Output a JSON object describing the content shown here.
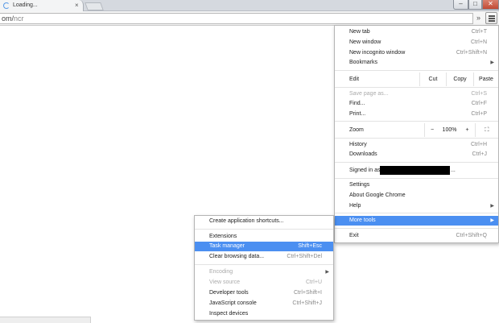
{
  "tab": {
    "title": "Loading..."
  },
  "window_controls": {
    "minimize": "–",
    "maximize": "□",
    "close": "✕"
  },
  "omnibox": {
    "url_host_tail": "om/",
    "url_path": "ncr",
    "overflow": "»"
  },
  "main_menu": {
    "new_tab": {
      "label": "New tab",
      "shortcut": "Ctrl+T"
    },
    "new_window": {
      "label": "New window",
      "shortcut": "Ctrl+N"
    },
    "new_incognito": {
      "label": "New incognito window",
      "shortcut": "Ctrl+Shift+N"
    },
    "bookmarks": {
      "label": "Bookmarks"
    },
    "edit": {
      "label": "Edit",
      "cut": "Cut",
      "copy": "Copy",
      "paste": "Paste"
    },
    "save_page": {
      "label": "Save page as...",
      "shortcut": "Ctrl+S"
    },
    "find": {
      "label": "Find...",
      "shortcut": "Ctrl+F"
    },
    "print": {
      "label": "Print...",
      "shortcut": "Ctrl+P"
    },
    "zoom": {
      "label": "Zoom",
      "minus": "−",
      "value": "100%",
      "plus": "+",
      "fullscreen": "⛶"
    },
    "history": {
      "label": "History",
      "shortcut": "Ctrl+H"
    },
    "downloads": {
      "label": "Downloads",
      "shortcut": "Ctrl+J"
    },
    "signed_in": {
      "label": "Signed in as",
      "suffix": "..."
    },
    "settings": {
      "label": "Settings"
    },
    "about": {
      "label": "About Google Chrome"
    },
    "help": {
      "label": "Help"
    },
    "more_tools": {
      "label": "More tools"
    },
    "exit": {
      "label": "Exit",
      "shortcut": "Ctrl+Shift+Q"
    }
  },
  "more_tools_menu": {
    "create_shortcuts": {
      "label": "Create application shortcuts..."
    },
    "extensions": {
      "label": "Extensions"
    },
    "task_manager": {
      "label": "Task manager",
      "shortcut": "Shift+Esc"
    },
    "clear_data": {
      "label": "Clear browsing data...",
      "shortcut": "Ctrl+Shift+Del"
    },
    "encoding": {
      "label": "Encoding"
    },
    "view_source": {
      "label": "View source",
      "shortcut": "Ctrl+U"
    },
    "dev_tools": {
      "label": "Developer tools",
      "shortcut": "Ctrl+Shift+I"
    },
    "js_console": {
      "label": "JavaScript console",
      "shortcut": "Ctrl+Shift+J"
    },
    "inspect_devices": {
      "label": "Inspect devices"
    }
  },
  "colors": {
    "highlight": "#4b8ff1",
    "close_button": "#c24a34",
    "spinner": "#5a9be6"
  },
  "icons": {
    "tab_spinner": "loading-spinner-icon",
    "menu": "hamburger-menu-icon",
    "submenu_arrow": "triangle-right-icon"
  }
}
